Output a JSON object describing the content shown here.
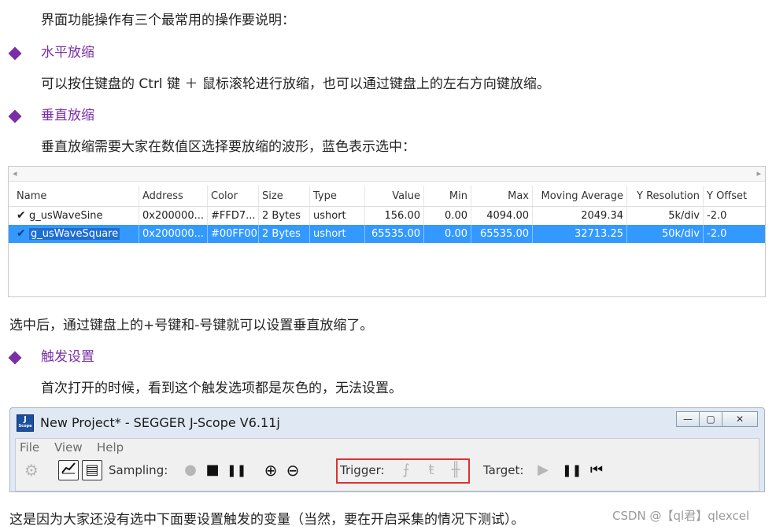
{
  "doc": {
    "intro": "界面功能操作有三个最常用的操作要说明：",
    "h1": "水平放缩",
    "p1": "可以按住键盘的 Ctrl 键 ＋ 鼠标滚轮进行放缩，也可以通过键盘上的左右方向键放缩。",
    "h2": "垂直放缩",
    "p2": "垂直放缩需要大家在数值区选择要放缩的波形，蓝色表示选中：",
    "p3": "选中后，通过键盘上的+号键和-号键就可以设置垂直放缩了。",
    "h3": "触发设置",
    "p4": "首次打开的时候，看到这个触发选项都是灰色的，无法设置。",
    "p5": "这是因为大家还没有选中下面要设置触发的变量（当然，要在开启采集的情况下测试）。"
  },
  "table": {
    "columns": [
      "Name",
      "Address",
      "Color",
      "Size",
      "Type",
      "Value",
      "Min",
      "Max",
      "Moving Average",
      "Y Resolution",
      "Y Offset"
    ],
    "rows": [
      {
        "name": "g_usWaveSine",
        "address": "0x200000...",
        "color": "#FFD7...",
        "size": "2 Bytes",
        "type": "ushort",
        "value": "156.00",
        "min": "0.00",
        "max": "4094.00",
        "avg": "2049.34",
        "yres": "5k/div",
        "yoff": "-2.0",
        "selected": false
      },
      {
        "name": "g_usWaveSquare",
        "address": "0x200000...",
        "color": "#00FF00",
        "size": "2 Bytes",
        "type": "ushort",
        "value": "65535.00",
        "min": "0.00",
        "max": "65535.00",
        "avg": "32713.25",
        "yres": "50k/div",
        "yoff": "-2.0",
        "selected": true
      }
    ],
    "check": "✔",
    "scroll_left": "◂",
    "scroll_right": "▸"
  },
  "window": {
    "title": "New Project* - SEGGER J-Scope V6.11j",
    "icon_text": "J",
    "icon_sub": "Scope",
    "minimize": "—",
    "maximize": "▢",
    "close": "✕",
    "menu": [
      "File",
      "View",
      "Help"
    ],
    "sampling_label": "Sampling:",
    "trigger_label": "Trigger:",
    "target_label": "Target:",
    "icons": {
      "gear": "⚙",
      "chart": "📈",
      "list": "▤",
      "record": "●",
      "stop": "■",
      "pause": "❚❚",
      "zoom_in": "⊕",
      "zoom_out": "⊖",
      "trig_rise": "⨍",
      "trig_fall": "ŧ",
      "trig_both": "╫",
      "play": "▶",
      "target_pause": "❚❚",
      "skip_start": "⏮"
    }
  },
  "watermark": "CSDN @【ql君】qlexcel"
}
